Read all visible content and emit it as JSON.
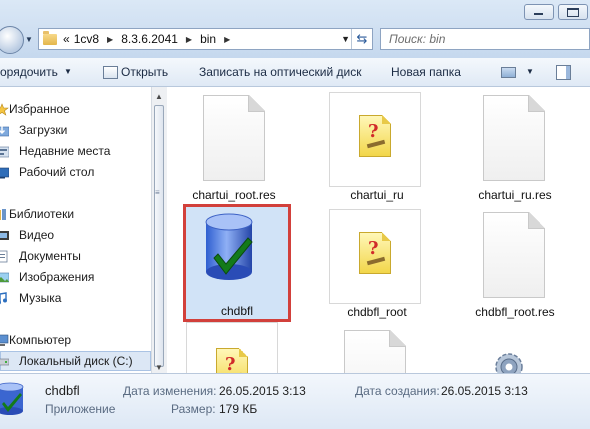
{
  "address": {
    "overflow": "«",
    "crumbs": [
      "1cv8",
      "8.3.6.2041",
      "bin"
    ],
    "search_placeholder": "Поиск: bin"
  },
  "toolbar": {
    "organize": "орядочить",
    "open": "Открыть",
    "burn": "Записать на оптический диск",
    "new_folder": "Новая папка"
  },
  "nav": {
    "items": [
      {
        "label": "Избранное",
        "icon": "star-icon"
      },
      {
        "label": "Загрузки",
        "icon": "downloads-folder-icon"
      },
      {
        "label": "Недавние места",
        "icon": "recent-places-icon"
      },
      {
        "label": "Рабочий стол",
        "icon": "desktop-icon"
      },
      {
        "label": "Библиотеки",
        "icon": "libraries-icon"
      },
      {
        "label": "Видео",
        "icon": "video-library-icon"
      },
      {
        "label": "Документы",
        "icon": "documents-library-icon"
      },
      {
        "label": "Изображения",
        "icon": "pictures-library-icon"
      },
      {
        "label": "Музыка",
        "icon": "music-library-icon"
      },
      {
        "label": "Компьютер",
        "icon": "computer-icon"
      },
      {
        "label": "Локальный диск (C:)",
        "icon": "drive-icon"
      }
    ]
  },
  "files": [
    {
      "name": "chartui_root.res",
      "type": "document"
    },
    {
      "name": "chartui_ru",
      "type": "help"
    },
    {
      "name": "chartui_ru.res",
      "type": "document"
    },
    {
      "name": "chdbfl",
      "type": "database",
      "selected": true
    },
    {
      "name": "chdbfl_root",
      "type": "help"
    },
    {
      "name": "chdbfl_root.res",
      "type": "document"
    },
    {
      "name": "",
      "type": "help"
    },
    {
      "name": "",
      "type": "document"
    },
    {
      "name": "",
      "type": "settings"
    }
  ],
  "details": {
    "name": "chdbfl",
    "kind": "Приложение",
    "modified_label": "Дата изменения:",
    "modified_value": "26.05.2015 3:13",
    "size_label": "Размер:",
    "size_value": "179 КБ",
    "created_label": "Дата создания:",
    "created_value": "26.05.2015 3:13"
  },
  "colors": {
    "selection_border": "#d2403b",
    "selection_fill": "#d1e3f7",
    "chrome": "#dbe8f6"
  }
}
